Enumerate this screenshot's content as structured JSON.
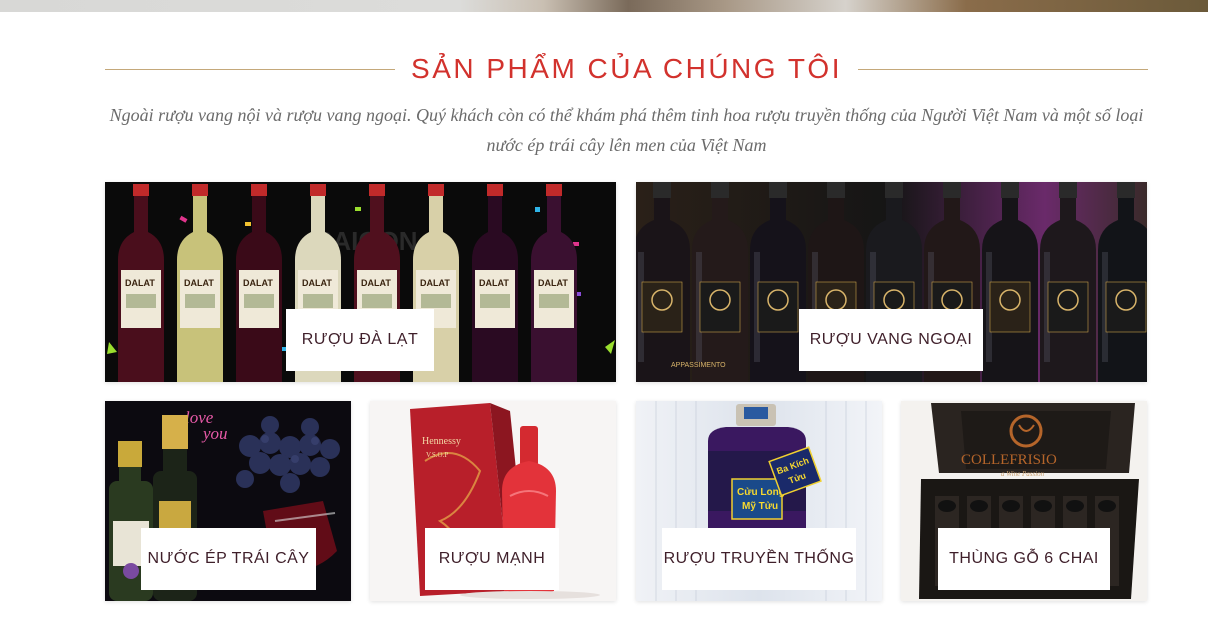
{
  "section": {
    "title": "SẢN PHẨM CỦA CHÚNG TÔI",
    "subtitle": "Ngoài rượu vang nội và rượu vang ngoại. Quý khách còn có thể khám phá thêm tinh hoa rượu truyền thống của Người Việt Nam và một số loại nước ép trái cây lên men của Việt Nam"
  },
  "categories": [
    {
      "label": "RƯỢU ĐÀ LẠT",
      "bottle_text": "DALAT",
      "bg_text": "SAIGON"
    },
    {
      "label": "RƯỢU VANG NGOẠI",
      "bottle_text": "APPASSIMENTO"
    },
    {
      "label": "NƯỚC ÉP TRÁI CÂY",
      "neon_text_1": "love",
      "neon_text_2": "you"
    },
    {
      "label": "RƯỢU MẠNH",
      "box_text_1": "Hennessy",
      "box_text_2": "V.S.O.P"
    },
    {
      "label": "RƯỢU TRUYỀN THỐNG",
      "bottle_text_1": "Cửu Long",
      "bottle_text_2": "Mỹ Tửu",
      "tag_text_1": "Ba Kích",
      "tag_text_2": "Tửu"
    },
    {
      "label": "THÙNG GỖ 6 CHAI",
      "box_text_1": "COLLEFRISIO",
      "box_text_2": "a Wine Passion"
    }
  ],
  "colors": {
    "title": "#d2322d",
    "label": "#3f1f2a",
    "rule": "#c4a87a",
    "subtitle": "#6b6b6b"
  }
}
